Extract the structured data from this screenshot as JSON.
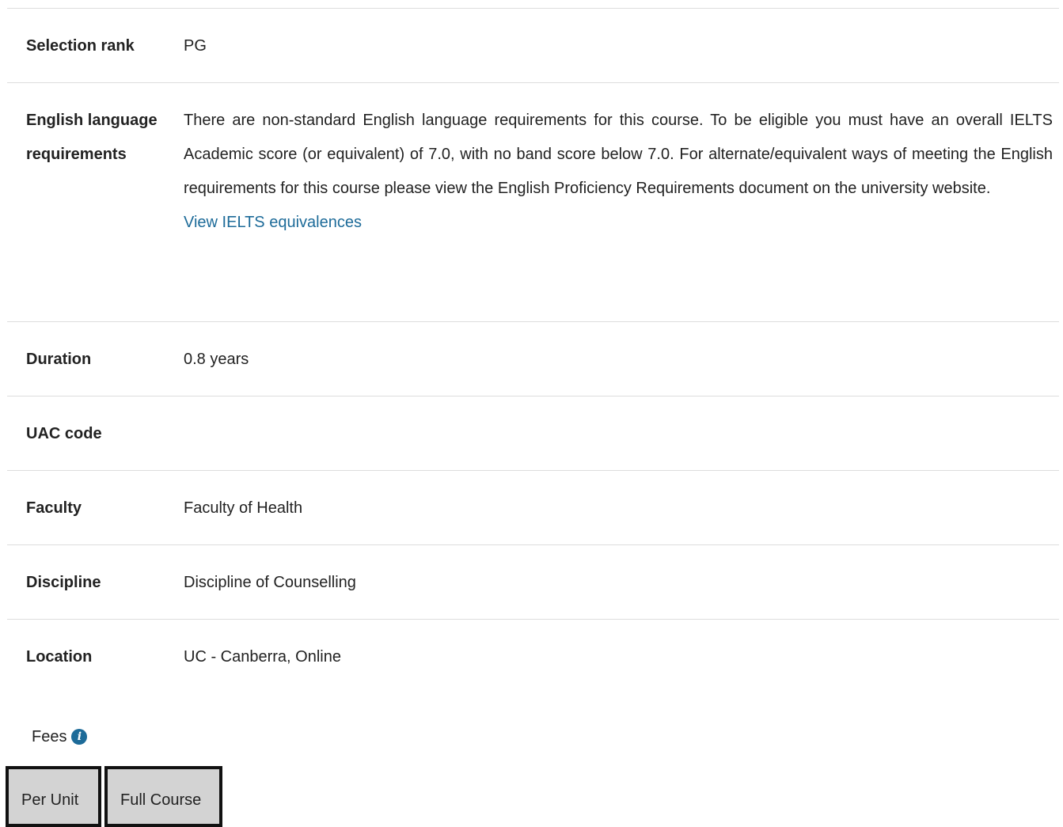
{
  "rows": {
    "selection_rank": {
      "label": "Selection rank",
      "value": "PG"
    },
    "english": {
      "label_line1": "English language",
      "label_line2": "requirements",
      "value": "There are non-standard English language requirements for this course. To be eligible you must have an overall IELTS Academic score (or equivalent) of 7.0, with no band score below 7.0. For alternate/equivalent ways of meeting the English requirements for this course please view the English Proficiency Requirements document on the university website.",
      "link": "View IELTS equivalences"
    },
    "duration": {
      "label": "Duration",
      "value": "0.8 years"
    },
    "uac_code": {
      "label": "UAC code",
      "value": ""
    },
    "faculty": {
      "label": "Faculty",
      "value": "Faculty of Health"
    },
    "discipline": {
      "label": "Discipline",
      "value": "Discipline of Counselling"
    },
    "location": {
      "label": "Location",
      "value": "UC - Canberra, Online"
    }
  },
  "fees": {
    "label": "Fees",
    "info_icon": "info-icon",
    "info_glyph": "i",
    "tabs": [
      {
        "label": "Per Unit"
      },
      {
        "label": "Full Course"
      }
    ]
  },
  "colors": {
    "link": "#1d6b99",
    "divider": "#dddddd",
    "tab_background": "#d3d3d3",
    "tab_border": "#111111"
  }
}
